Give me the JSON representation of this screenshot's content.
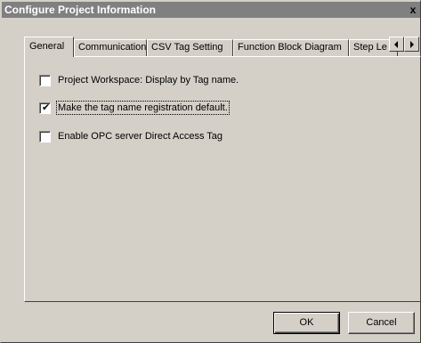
{
  "window": {
    "title": "Configure Project Information",
    "close_label": "x"
  },
  "tabs": [
    {
      "label": "General",
      "active": true
    },
    {
      "label": "Communication",
      "active": false
    },
    {
      "label": "CSV Tag Setting",
      "active": false
    },
    {
      "label": "Function Block Diagram",
      "active": false
    },
    {
      "label": "Step Le",
      "active": false
    }
  ],
  "options": [
    {
      "label": "Project Workspace: Display by Tag name.",
      "checked": false
    },
    {
      "label": "Make the tag name registration default.",
      "checked": true
    },
    {
      "label": "Enable OPC server Direct Access Tag",
      "checked": false
    }
  ],
  "buttons": {
    "ok_label": "OK",
    "cancel_label": "Cancel"
  },
  "checkmark_glyph": "✔"
}
